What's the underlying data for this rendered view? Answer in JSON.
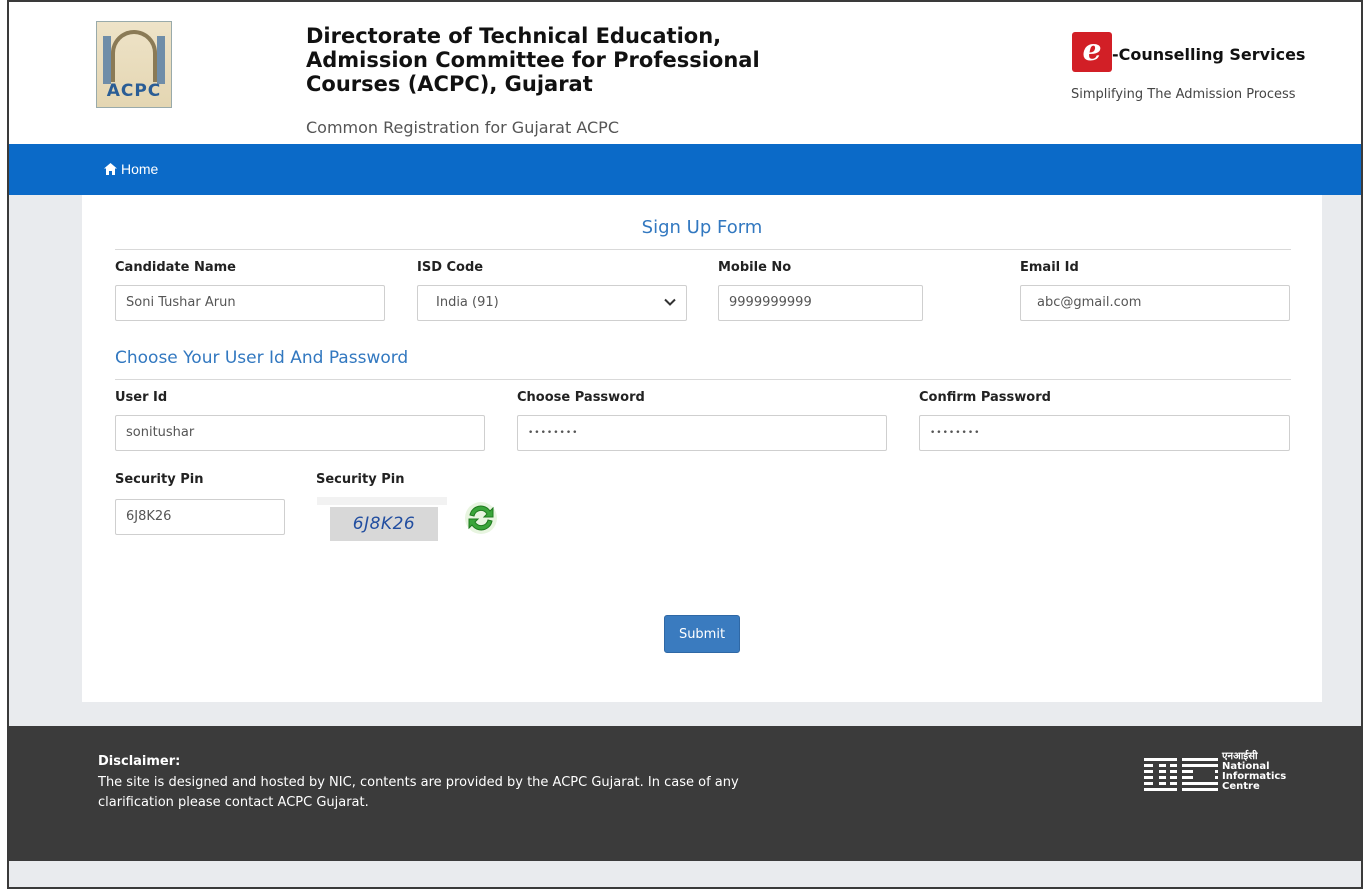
{
  "header": {
    "org_title_line1": "Directorate of Technical Education,",
    "org_title_line2": "Admission Committee for Professional",
    "org_title_line3": "Courses (ACPC), Gujarat",
    "subtitle": "Common Registration for Gujarat ACPC",
    "acpc_logo_text": "ACPC",
    "ec_logo_glyph": "e",
    "ec_title": "-Counselling Services",
    "ec_tagline": "Simplifying The Admission Process"
  },
  "nav": {
    "home_label": "Home"
  },
  "form": {
    "title": "Sign Up Form",
    "candidate_name": {
      "label": "Candidate Name",
      "value": "Soni Tushar Arun"
    },
    "isd_code": {
      "label": "ISD Code",
      "value": "India (91)"
    },
    "mobile_no": {
      "label": "Mobile No",
      "value": "9999999999"
    },
    "email_id": {
      "label": "Email Id",
      "value": "abc@gmail.com"
    },
    "section_title": "Choose Your User Id And Password",
    "user_id": {
      "label": "User Id",
      "value": "sonitushar"
    },
    "choose_password": {
      "label": "Choose Password",
      "value": "••••••••"
    },
    "confirm_password": {
      "label": "Confirm Password",
      "value": "••••••••"
    },
    "security_pin_input": {
      "label": "Security Pin",
      "value": "6J8K26"
    },
    "security_pin_captcha": {
      "label": "Security Pin",
      "value": "6J8K26"
    },
    "submit_label": "Submit"
  },
  "footer": {
    "disclaimer_title": "Disclaimer:",
    "disclaimer_line1": "The site is designed and hosted by NIC, contents are provided by the ACPC Gujarat. In case of any",
    "disclaimer_line2": "clarification please contact ACPC Gujarat.",
    "nic_hindi": "एनआईसी",
    "nic_line1": "National",
    "nic_line2": "Informatics",
    "nic_line3": "Centre"
  },
  "colors": {
    "nav_blue": "#0b6ac8",
    "heading_blue": "#3278c0",
    "button_blue": "#3a7bbf",
    "footer_dark": "#3b3b3b",
    "ec_red": "#d21f26"
  }
}
